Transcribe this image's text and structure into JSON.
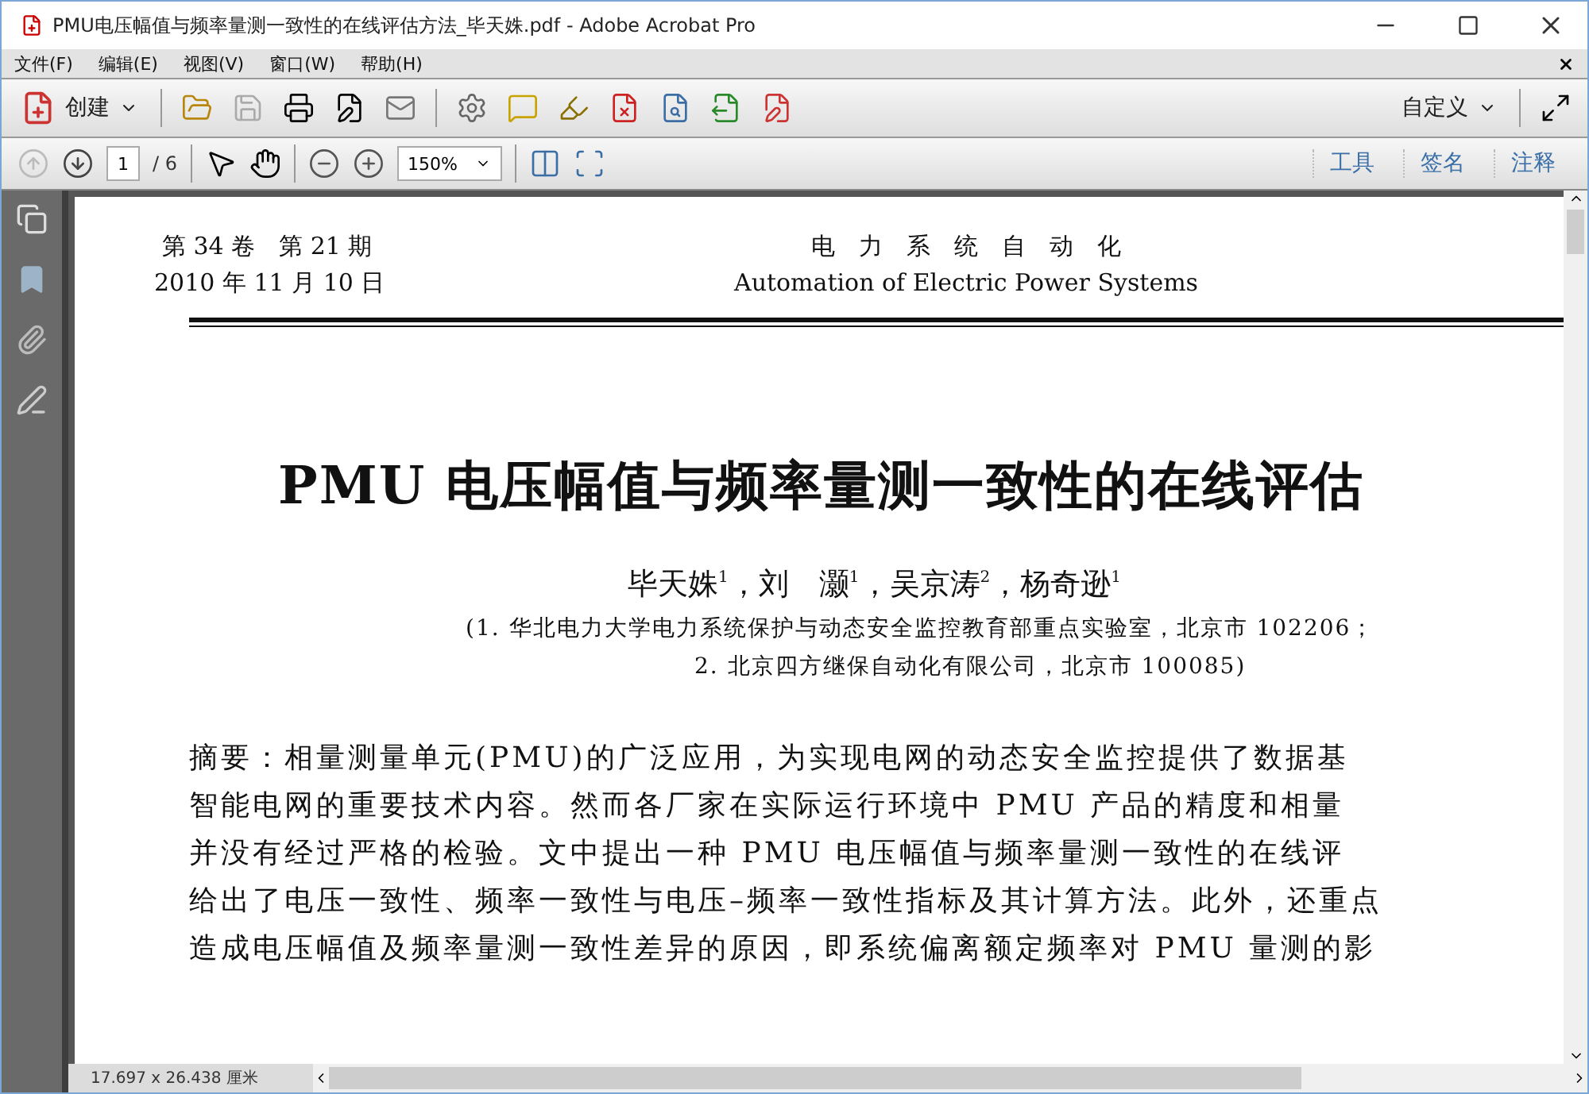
{
  "window": {
    "title": "PMU电压幅值与频率量测一致性的在线评估方法_毕天姝.pdf - Adobe Acrobat Pro"
  },
  "menu": [
    "文件(F)",
    "编辑(E)",
    "视图(V)",
    "窗口(W)",
    "帮助(H)"
  ],
  "toolbar": {
    "create": "创建",
    "customize": "自定义"
  },
  "navigation": {
    "page": "1",
    "page_count": "/ 6",
    "zoom": "150%"
  },
  "panes": [
    "工具",
    "签名",
    "注释"
  ],
  "document": {
    "journal_issue": "第 34 卷　第 21 期",
    "journal_date": "2010 年 11 月 10 日",
    "journal_name": "电　力　系　统　自　动　化",
    "journal_name_en": "Automation of Electric Power Systems",
    "title": "PMU 电压幅值与频率量测一致性的在线评估",
    "authors": "毕天姝$^{1}$，刘　灏$^{1}$，吴京涛$^{2}$，杨奇逊$^{1}$",
    "affiliations": [
      "(1. 华北电力大学电力系统保护与动态安全监控教育部重点实验室，北京市 102206；",
      "2. 北京四方继保自动化有限公司，北京市 100085)"
    ],
    "abstract": [
      "摘要：相量测量单元(PMU)的广泛应用，为实现电网的动态安全监控提供了数据基",
      "智能电网的重要技术内容。然而各厂家在实际运行环境中 PMU 产品的精度和相量",
      "并没有经过严格的检验。文中提出一种 PMU 电压幅值与频率量测一致性的在线评",
      "给出了电压一致性、频率一致性与电压–频率一致性指标及其计算方法。此外，还重点",
      "造成电压幅值及频率量测一致性差异的原因，即系统偏离额定频率对 PMU 量测的影"
    ]
  },
  "status_bar": {
    "page_size": "17.697 x 26.438 厘米"
  }
}
